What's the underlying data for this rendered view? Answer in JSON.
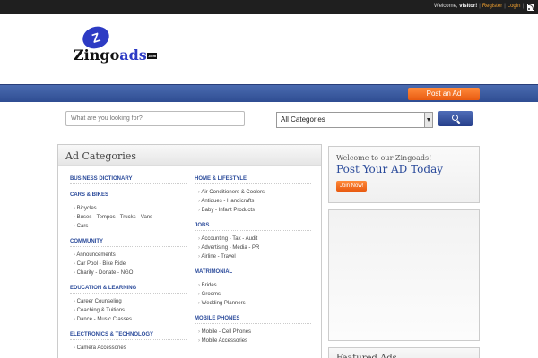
{
  "topbar": {
    "welcome_prefix": "Welcome,",
    "visitor": "visitor!",
    "register": "Register",
    "login": "Login",
    "rss_icon": "rss-icon"
  },
  "logo": {
    "letter": "Z",
    "word_main": "Zingo",
    "word_accent": "ads",
    "suffix": ".com"
  },
  "nav": {
    "post_ad": "Post an Ad"
  },
  "search": {
    "placeholder": "What are you looking for?",
    "category_selected": "All Categories",
    "button_icon": "search-icon"
  },
  "categories": {
    "title": "Ad Categories",
    "left": [
      {
        "title": "BUSINESS DICTIONARY",
        "items": []
      },
      {
        "title": "CARS & BIKES",
        "items": [
          "Bicycles",
          "Buses - Tempos - Trucks - Vans",
          "Cars"
        ]
      },
      {
        "title": "COMMUNITY",
        "items": [
          "Announcements",
          "Car Pool - Bike Ride",
          "Charity - Donate - NGO"
        ]
      },
      {
        "title": "EDUCATION & LEARNING",
        "items": [
          "Career Counseling",
          "Coaching & Tuitions",
          "Dance - Music Classes"
        ]
      },
      {
        "title": "ELECTRONICS & TECHNOLOGY",
        "items": [
          "Camera Accessories"
        ]
      }
    ],
    "right": [
      {
        "title": "HOME & LIFESTYLE",
        "items": [
          "Air Conditioners & Coolers",
          "Antiques - Handicrafts",
          "Baby - Infant Products"
        ]
      },
      {
        "title": "JOBS",
        "items": [
          "Accounting - Tax - Audit",
          "Advertising - Media - PR",
          "Airline - Travel"
        ]
      },
      {
        "title": "MATRIMONIAL",
        "items": [
          "Brides",
          "Grooms",
          "Wedding Planners"
        ]
      },
      {
        "title": "MOBILE PHONES",
        "items": [
          "Mobile - Cell Phones",
          "Mobile Accessories"
        ]
      }
    ]
  },
  "welcome_panel": {
    "line1": "Welcome to our Zingoads!",
    "line2": "Post Your AD Today",
    "join": "Join Now!"
  },
  "featured": {
    "title": "Featured Ads"
  }
}
